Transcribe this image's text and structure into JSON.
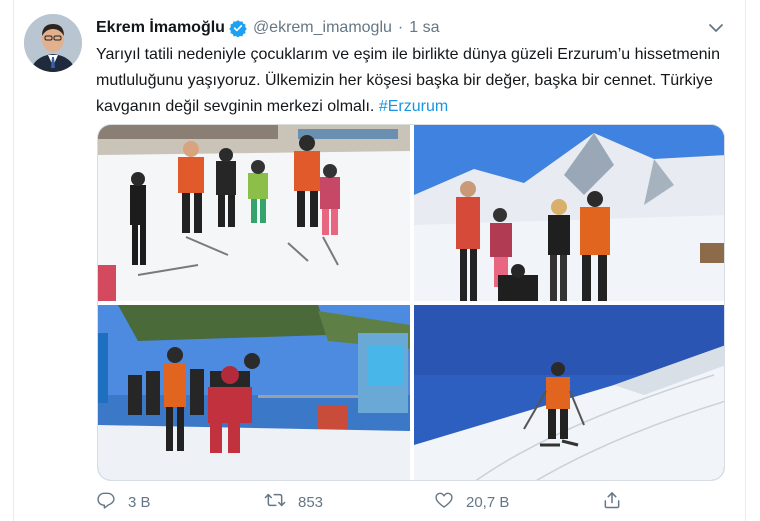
{
  "tweet": {
    "author_name": "Ekrem İmamoğlu",
    "handle": "@ekrem_imamoglu",
    "separator": "·",
    "time": "1 sa",
    "text_main": "Yarıyıl tatili nedeniyle çocuklarım ve eşim ile birlikte dünya güzeli Erzurum’u hissetmenin mutluluğunu yaşıyoruz. Ülkemizin her köşesi başka bir değer, başka bir cennet. Türkiye kavganın değil sevginin merkezi olmalı.",
    "hashtag": "#Erzurum",
    "icons": {
      "verified": "verified-badge-icon",
      "menu": "chevron-down-icon",
      "reply": "reply-icon",
      "retweet": "retweet-icon",
      "like": "heart-icon",
      "share": "share-icon"
    },
    "colors": {
      "accent": "#1b95e0",
      "muted": "#657786",
      "text": "#14171a"
    }
  },
  "actions": {
    "replies": "3 B",
    "retweets": "853",
    "likes": "20,7 B"
  }
}
